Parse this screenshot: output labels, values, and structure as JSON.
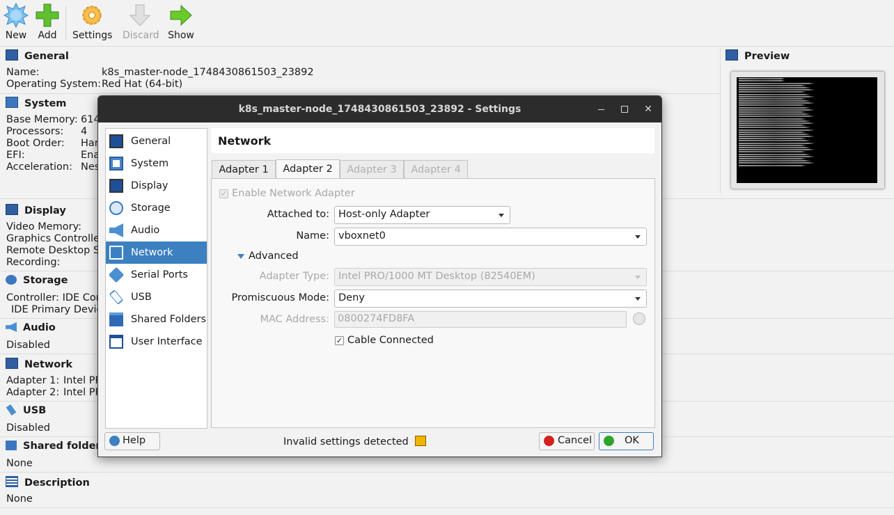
{
  "toolbar": {
    "new_label": "New",
    "add_label": "Add",
    "settings_label": "Settings",
    "discard_label": "Discard",
    "show_label": "Show"
  },
  "details": {
    "general": {
      "title": "General",
      "name_label": "Name:",
      "name_value": "k8s_master-node_1748430861503_23892",
      "os_label": "Operating System:",
      "os_value": "Red Hat (64-bit)"
    },
    "system": {
      "title": "System",
      "rows": [
        {
          "label": "Base Memory:",
          "value": "614"
        },
        {
          "label": "Processors:",
          "value": "4"
        },
        {
          "label": "Boot Order:",
          "value": "Har"
        },
        {
          "label": "EFI:",
          "value": "Ena"
        },
        {
          "label": "Acceleration:",
          "value": "Nes"
        }
      ]
    },
    "display": {
      "title": "Display",
      "rows": [
        {
          "label": "Video Memory:"
        },
        {
          "label": "Graphics Controller"
        },
        {
          "label": "Remote Desktop Se"
        },
        {
          "label": "Recording:"
        }
      ]
    },
    "storage": {
      "title": "Storage",
      "row1": "Controller: IDE Con",
      "row2": " IDE Primary Device"
    },
    "audio": {
      "title": "Audio",
      "row1": "Disabled"
    },
    "network": {
      "title": "Network",
      "row1_label": "Adapter 1:",
      "row1_value": "Intel PR",
      "row2_label": "Adapter 2:",
      "row2_value": "Intel PR"
    },
    "usb": {
      "title": "USB",
      "row1": "Disabled"
    },
    "shared": {
      "title": "Shared folders",
      "row1": "None"
    },
    "description": {
      "title": "Description",
      "row1": "None"
    },
    "preview": {
      "title": "Preview"
    }
  },
  "dialog": {
    "title": "k8s_master-node_1748430861503_23892 - Settings",
    "categories": [
      {
        "label": "General",
        "icon": "monitor-icon"
      },
      {
        "label": "System",
        "icon": "chip-icon"
      },
      {
        "label": "Display",
        "icon": "display-icon"
      },
      {
        "label": "Storage",
        "icon": "disk-icon"
      },
      {
        "label": "Audio",
        "icon": "speaker-icon"
      },
      {
        "label": "Network",
        "icon": "network-icon"
      },
      {
        "label": "Serial Ports",
        "icon": "serial-port-icon"
      },
      {
        "label": "USB",
        "icon": "usb-icon"
      },
      {
        "label": "Shared Folders",
        "icon": "folder-icon"
      },
      {
        "label": "User Interface",
        "icon": "window-icon"
      }
    ],
    "selected_category": "Network",
    "page_title": "Network",
    "tabs": [
      "Adapter 1",
      "Adapter 2",
      "Adapter 3",
      "Adapter 4"
    ],
    "active_tab": "Adapter 2",
    "enable_label": "Enable Network Adapter",
    "attached_label": "Attached to:",
    "attached_value": "Host-only Adapter",
    "name_label": "Name:",
    "name_value": "vboxnet0",
    "advanced_label": "Advanced",
    "adapter_type_label": "Adapter Type:",
    "adapter_type_value": "Intel PRO/1000 MT Desktop (82540EM)",
    "promisc_label": "Promiscuous Mode:",
    "promisc_value": "Deny",
    "mac_label": "MAC Address:",
    "mac_value": "0800274FD8FA",
    "cable_label": "Cable Connected",
    "help_label": "Help",
    "status_text": "Invalid settings detected",
    "cancel_label": "Cancel",
    "ok_label": "OK"
  },
  "colors": {
    "selection": "#3c80c1",
    "titlebar": "#2c2c2c"
  }
}
